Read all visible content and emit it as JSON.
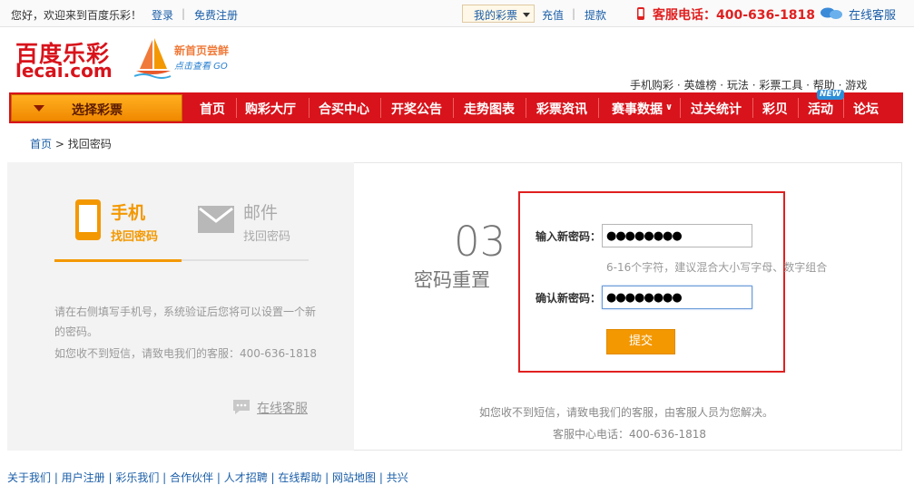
{
  "topbar": {
    "greeting": "您好，欢迎来到百度乐彩！",
    "login": "登录",
    "register": "免费注册",
    "my_lottery": "我的彩票",
    "recharge": "充值",
    "withdraw": "提款",
    "hotline": "客服电话：400-636-1818",
    "online_service": "在线客服"
  },
  "header": {
    "logo_cn": "百度乐彩",
    "logo_en": "lecai.com",
    "promo_line1": "新首页尝鲜",
    "promo_line2": "点击查看 GO",
    "sub_links": "手机购彩 · 英雄榜 · 玩法 · 彩票工具 · 帮助 · 游戏"
  },
  "nav": {
    "select_lottery": "选择彩票",
    "items": [
      "首页",
      "购彩大厅",
      "合买中心",
      "开奖公告",
      "走势图表",
      "彩票资讯",
      "赛事数据",
      "过关统计",
      "彩贝",
      "活动",
      "论坛"
    ],
    "new_badge": "NEW"
  },
  "breadcrumb": {
    "home": "首页",
    "separator": ">",
    "current": "找回密码"
  },
  "left_panel": {
    "tab_phone_title": "手机",
    "tab_phone_sub": "找回密码",
    "tab_mail_title": "邮件",
    "tab_mail_sub": "找回密码",
    "tip": "请在右侧填写手机号，系统验证后您将可以设置一个新的密码。",
    "tip2": "如您收不到短信，请致电我们的客服：400-636-1818",
    "online_service": "在线客服"
  },
  "step": {
    "number": "03",
    "label": "密码重置"
  },
  "form": {
    "new_pwd_label": "输入新密码：",
    "new_pwd_value": "●●●●●●●●",
    "hint": "6-16个字符，建议混合大小写字母、数字组合",
    "confirm_label": "确认新密码：",
    "confirm_value": "●●●●●●●●",
    "submit": "提交"
  },
  "footer_note": {
    "line1": "如您收不到短信，请致电我们的客服，由客服人员为您解决。",
    "line2": "客服中心电话：400-636-1818"
  },
  "bottom_links": "关于我们 | 用户注册 | 彩乐我们 | 合作伙伴 | 人才招聘 | 在线帮助 | 网站地图 | 共兴",
  "colors": {
    "brand_red": "#d8131b",
    "accent_orange": "#f39800",
    "link_blue": "#1a5ea8"
  }
}
